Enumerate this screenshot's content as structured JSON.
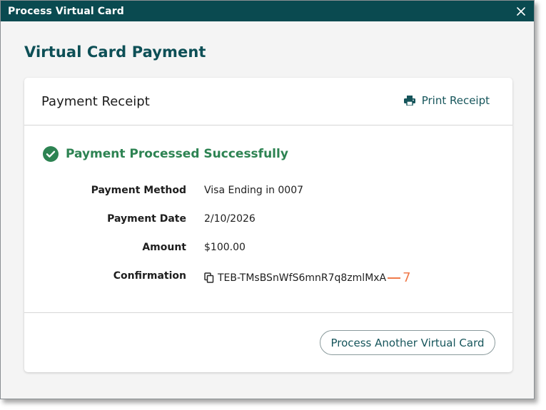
{
  "window": {
    "title": "Process Virtual Card",
    "close_icon": "close-icon"
  },
  "page": {
    "heading": "Virtual Card Payment"
  },
  "receipt": {
    "title": "Payment Receipt",
    "print_label": "Print Receipt",
    "print_icon": "printer-icon",
    "status_text": "Payment Processed Successfully",
    "status_icon": "check-circle-icon",
    "fields": [
      {
        "label": "Payment Method",
        "value": "Visa Ending in 0007"
      },
      {
        "label": "Payment Date",
        "value": "2/10/2026"
      },
      {
        "label": "Amount",
        "value": "$100.00"
      },
      {
        "label": "Confirmation",
        "value": "TEB-TMsBSnWfS6mnR7q8zmlMxA"
      }
    ],
    "copy_icon": "copy-icon",
    "annotation_number": "7",
    "action_label": "Process Another Virtual Card"
  },
  "colors": {
    "titlebar": "#0a4a50",
    "heading": "#0d4f56",
    "success": "#2d8352",
    "link": "#16555b",
    "annotation": "#f07a4a"
  }
}
